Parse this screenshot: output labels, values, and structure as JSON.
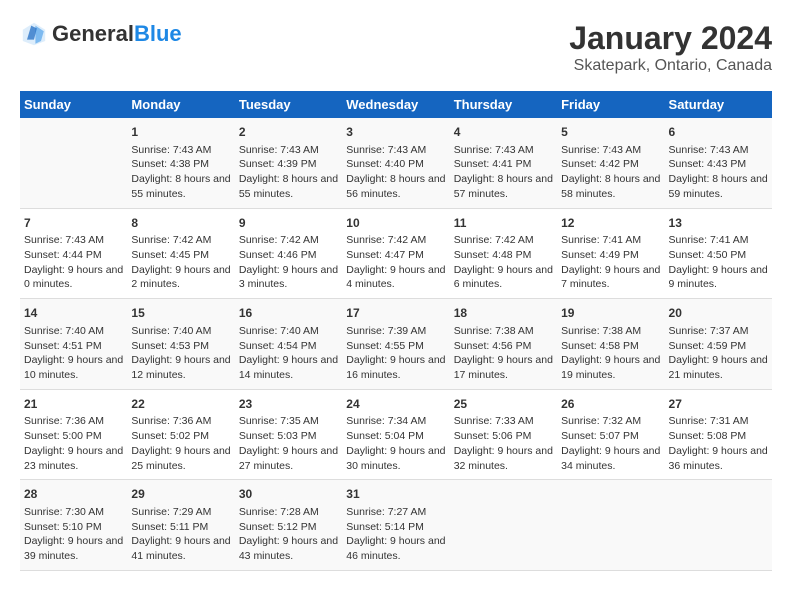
{
  "header": {
    "logo_general": "General",
    "logo_blue": "Blue",
    "title": "January 2024",
    "subtitle": "Skatepark, Ontario, Canada"
  },
  "days_of_week": [
    "Sunday",
    "Monday",
    "Tuesday",
    "Wednesday",
    "Thursday",
    "Friday",
    "Saturday"
  ],
  "weeks": [
    [
      {
        "day": "",
        "content": ""
      },
      {
        "day": "1",
        "content": "Sunrise: 7:43 AM\nSunset: 4:38 PM\nDaylight: 8 hours and 55 minutes."
      },
      {
        "day": "2",
        "content": "Sunrise: 7:43 AM\nSunset: 4:39 PM\nDaylight: 8 hours and 55 minutes."
      },
      {
        "day": "3",
        "content": "Sunrise: 7:43 AM\nSunset: 4:40 PM\nDaylight: 8 hours and 56 minutes."
      },
      {
        "day": "4",
        "content": "Sunrise: 7:43 AM\nSunset: 4:41 PM\nDaylight: 8 hours and 57 minutes."
      },
      {
        "day": "5",
        "content": "Sunrise: 7:43 AM\nSunset: 4:42 PM\nDaylight: 8 hours and 58 minutes."
      },
      {
        "day": "6",
        "content": "Sunrise: 7:43 AM\nSunset: 4:43 PM\nDaylight: 8 hours and 59 minutes."
      }
    ],
    [
      {
        "day": "7",
        "content": "Sunrise: 7:43 AM\nSunset: 4:44 PM\nDaylight: 9 hours and 0 minutes."
      },
      {
        "day": "8",
        "content": "Sunrise: 7:42 AM\nSunset: 4:45 PM\nDaylight: 9 hours and 2 minutes."
      },
      {
        "day": "9",
        "content": "Sunrise: 7:42 AM\nSunset: 4:46 PM\nDaylight: 9 hours and 3 minutes."
      },
      {
        "day": "10",
        "content": "Sunrise: 7:42 AM\nSunset: 4:47 PM\nDaylight: 9 hours and 4 minutes."
      },
      {
        "day": "11",
        "content": "Sunrise: 7:42 AM\nSunset: 4:48 PM\nDaylight: 9 hours and 6 minutes."
      },
      {
        "day": "12",
        "content": "Sunrise: 7:41 AM\nSunset: 4:49 PM\nDaylight: 9 hours and 7 minutes."
      },
      {
        "day": "13",
        "content": "Sunrise: 7:41 AM\nSunset: 4:50 PM\nDaylight: 9 hours and 9 minutes."
      }
    ],
    [
      {
        "day": "14",
        "content": "Sunrise: 7:40 AM\nSunset: 4:51 PM\nDaylight: 9 hours and 10 minutes."
      },
      {
        "day": "15",
        "content": "Sunrise: 7:40 AM\nSunset: 4:53 PM\nDaylight: 9 hours and 12 minutes."
      },
      {
        "day": "16",
        "content": "Sunrise: 7:40 AM\nSunset: 4:54 PM\nDaylight: 9 hours and 14 minutes."
      },
      {
        "day": "17",
        "content": "Sunrise: 7:39 AM\nSunset: 4:55 PM\nDaylight: 9 hours and 16 minutes."
      },
      {
        "day": "18",
        "content": "Sunrise: 7:38 AM\nSunset: 4:56 PM\nDaylight: 9 hours and 17 minutes."
      },
      {
        "day": "19",
        "content": "Sunrise: 7:38 AM\nSunset: 4:58 PM\nDaylight: 9 hours and 19 minutes."
      },
      {
        "day": "20",
        "content": "Sunrise: 7:37 AM\nSunset: 4:59 PM\nDaylight: 9 hours and 21 minutes."
      }
    ],
    [
      {
        "day": "21",
        "content": "Sunrise: 7:36 AM\nSunset: 5:00 PM\nDaylight: 9 hours and 23 minutes."
      },
      {
        "day": "22",
        "content": "Sunrise: 7:36 AM\nSunset: 5:02 PM\nDaylight: 9 hours and 25 minutes."
      },
      {
        "day": "23",
        "content": "Sunrise: 7:35 AM\nSunset: 5:03 PM\nDaylight: 9 hours and 27 minutes."
      },
      {
        "day": "24",
        "content": "Sunrise: 7:34 AM\nSunset: 5:04 PM\nDaylight: 9 hours and 30 minutes."
      },
      {
        "day": "25",
        "content": "Sunrise: 7:33 AM\nSunset: 5:06 PM\nDaylight: 9 hours and 32 minutes."
      },
      {
        "day": "26",
        "content": "Sunrise: 7:32 AM\nSunset: 5:07 PM\nDaylight: 9 hours and 34 minutes."
      },
      {
        "day": "27",
        "content": "Sunrise: 7:31 AM\nSunset: 5:08 PM\nDaylight: 9 hours and 36 minutes."
      }
    ],
    [
      {
        "day": "28",
        "content": "Sunrise: 7:30 AM\nSunset: 5:10 PM\nDaylight: 9 hours and 39 minutes."
      },
      {
        "day": "29",
        "content": "Sunrise: 7:29 AM\nSunset: 5:11 PM\nDaylight: 9 hours and 41 minutes."
      },
      {
        "day": "30",
        "content": "Sunrise: 7:28 AM\nSunset: 5:12 PM\nDaylight: 9 hours and 43 minutes."
      },
      {
        "day": "31",
        "content": "Sunrise: 7:27 AM\nSunset: 5:14 PM\nDaylight: 9 hours and 46 minutes."
      },
      {
        "day": "",
        "content": ""
      },
      {
        "day": "",
        "content": ""
      },
      {
        "day": "",
        "content": ""
      }
    ]
  ]
}
